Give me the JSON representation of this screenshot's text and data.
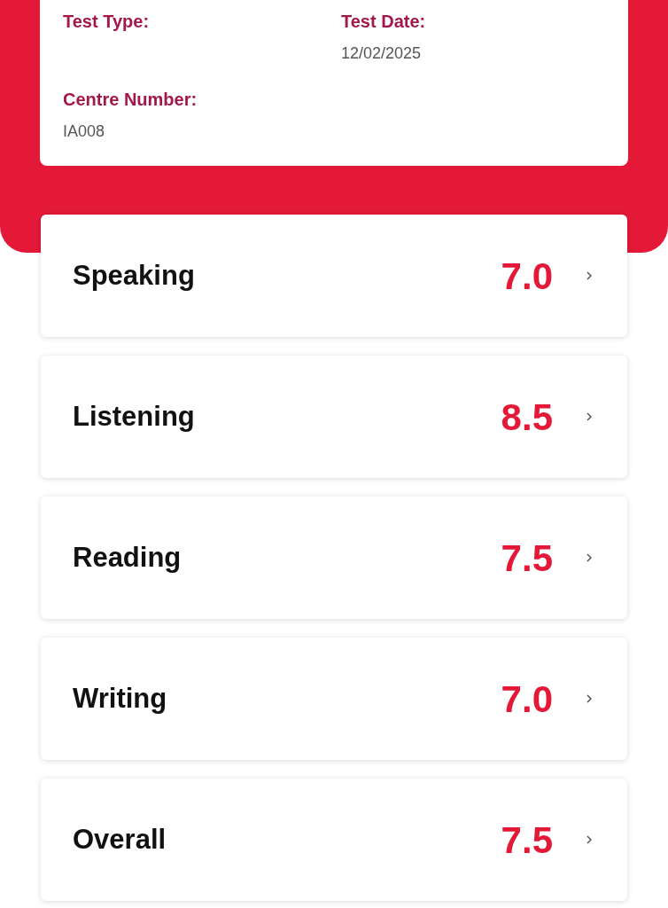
{
  "test_info": [
    {
      "label": "Test Type:"
    },
    {
      "label": "Test Date:",
      "value": "12/02/2025"
    },
    {
      "label": "Centre Number:",
      "value": "IA008"
    }
  ],
  "scores": [
    {
      "name": "Speaking",
      "score": "7.0"
    },
    {
      "name": "Listening",
      "score": "8.5"
    },
    {
      "name": "Reading",
      "score": "7.5"
    },
    {
      "name": "Writing",
      "score": "7.0"
    },
    {
      "name": "Overall",
      "score": "7.5"
    }
  ]
}
